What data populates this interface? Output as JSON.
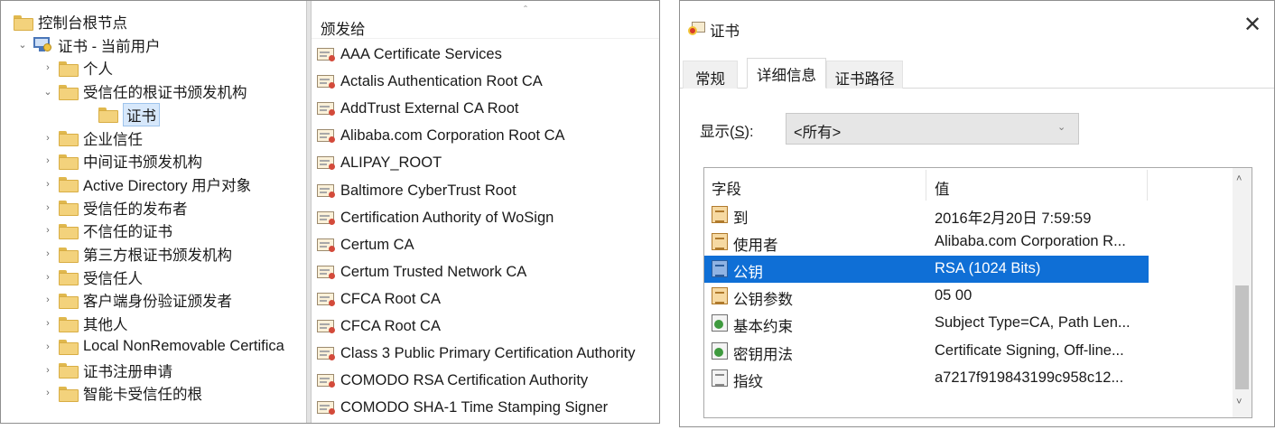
{
  "mmc": {
    "tree": [
      {
        "label": "控制台根节点",
        "level": 0,
        "toggle": "",
        "icon": "folder-icon"
      },
      {
        "label": "证书 - 当前用户",
        "level": 1,
        "toggle": "⌄",
        "icon": "certificate-store-icon"
      },
      {
        "label": "个人",
        "level": 2,
        "toggle": "›",
        "icon": "folder-icon"
      },
      {
        "label": "受信任的根证书颁发机构",
        "level": 2,
        "toggle": "⌄",
        "icon": "folder-icon"
      },
      {
        "label": "证书",
        "level": 3,
        "toggle": "",
        "icon": "folder-icon",
        "selected": true
      },
      {
        "label": "企业信任",
        "level": 2,
        "toggle": "›",
        "icon": "folder-icon"
      },
      {
        "label": "中间证书颁发机构",
        "level": 2,
        "toggle": "›",
        "icon": "folder-icon"
      },
      {
        "label": "Active Directory 用户对象",
        "level": 2,
        "toggle": "›",
        "icon": "folder-icon"
      },
      {
        "label": "受信任的发布者",
        "level": 2,
        "toggle": "›",
        "icon": "folder-icon"
      },
      {
        "label": "不信任的证书",
        "level": 2,
        "toggle": "›",
        "icon": "folder-icon"
      },
      {
        "label": "第三方根证书颁发机构",
        "level": 2,
        "toggle": "›",
        "icon": "folder-icon"
      },
      {
        "label": "受信任人",
        "level": 2,
        "toggle": "›",
        "icon": "folder-icon"
      },
      {
        "label": "客户端身份验证颁发者",
        "level": 2,
        "toggle": "›",
        "icon": "folder-icon"
      },
      {
        "label": "其他人",
        "level": 2,
        "toggle": "›",
        "icon": "folder-icon"
      },
      {
        "label": "Local NonRemovable Certifica",
        "level": 2,
        "toggle": "›",
        "icon": "folder-icon"
      },
      {
        "label": "证书注册申请",
        "level": 2,
        "toggle": "›",
        "icon": "folder-icon"
      },
      {
        "label": "智能卡受信任的根",
        "level": 2,
        "toggle": "›",
        "icon": "folder-icon"
      }
    ],
    "list_header": "颁发给",
    "sort_indicator": "ˆ",
    "certificates": [
      "AAA Certificate Services",
      "Actalis Authentication Root CA",
      "AddTrust External CA Root",
      "Alibaba.com Corporation Root CA",
      "ALIPAY_ROOT",
      "Baltimore CyberTrust Root",
      "Certification Authority of WoSign",
      "Certum CA",
      "Certum Trusted Network CA",
      "CFCA Root CA",
      "CFCA Root CA",
      "Class 3 Public Primary Certification Authority",
      "COMODO RSA Certification Authority",
      "COMODO SHA-1 Time Stamping Signer"
    ]
  },
  "dialog": {
    "title": "证书",
    "close_glyph": "✕",
    "tabs": [
      "常规",
      "详细信息",
      "证书路径"
    ],
    "active_tab": 1,
    "show_label_prefix": "显示(",
    "show_label_key": "S",
    "show_label_suffix": "):",
    "show_value": "<所有>",
    "combo_arrow": "⌄",
    "columns": {
      "field": "字段",
      "value": "值"
    },
    "rows": [
      {
        "field": "到",
        "value": "2016年2月20日 7:59:59",
        "icon": "property-icon"
      },
      {
        "field": "使用者",
        "value": "Alibaba.com Corporation R...",
        "icon": "property-icon"
      },
      {
        "field": "公钥",
        "value": "RSA (1024 Bits)",
        "icon": "public-key-icon",
        "selected": true
      },
      {
        "field": "公钥参数",
        "value": "05 00",
        "icon": "property-icon"
      },
      {
        "field": "基本约束",
        "value": "Subject Type=CA, Path Len...",
        "icon": "extension-icon"
      },
      {
        "field": "密钥用法",
        "value": "Certificate Signing, Off-line...",
        "icon": "extension-icon"
      },
      {
        "field": "指纹",
        "value": "a7217f919843199c958c12...",
        "icon": "thumbprint-icon"
      }
    ],
    "scroll_up": "˄",
    "scroll_down": "˅",
    "colors": {
      "selection": "#0f6fd6",
      "tree_selection": "#d7e8fb"
    }
  }
}
